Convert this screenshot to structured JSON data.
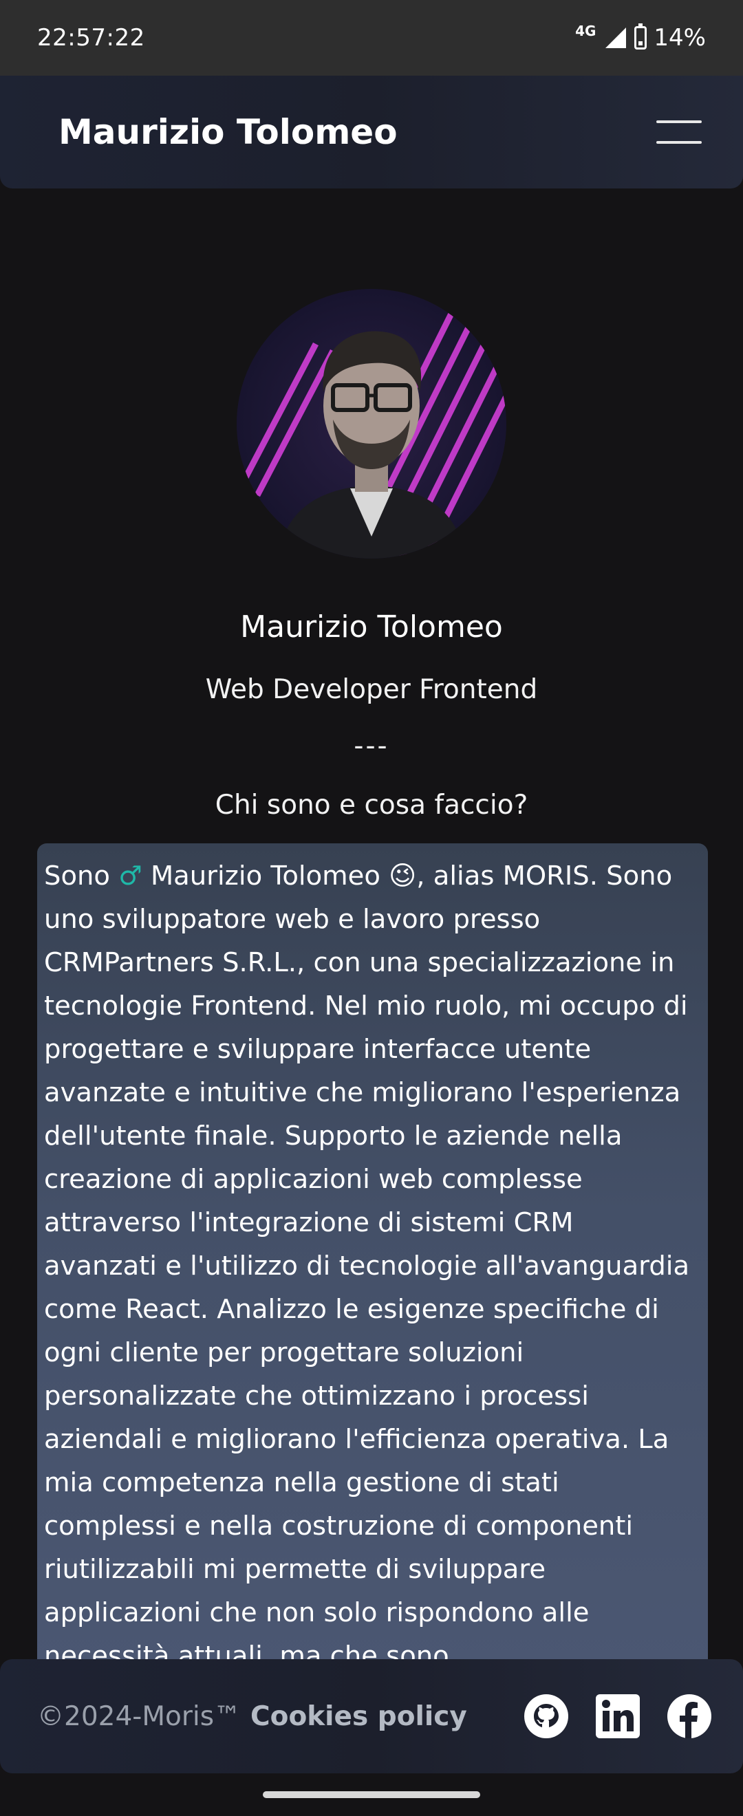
{
  "status_bar": {
    "time": "22:57:22",
    "network": "4G",
    "battery": "14%"
  },
  "header": {
    "brand": "Maurizio Tolomeo",
    "menu_icon": "hamburger-menu-icon"
  },
  "profile": {
    "name": "Maurizio Tolomeo",
    "role": "Web Developer Frontend",
    "divider": "---",
    "question": "Chi sono e cosa faccio?"
  },
  "bio": {
    "part1": "Sono ",
    "male_emoji": "♂",
    "part2": " Maurizio Tolomeo ",
    "wink_emoji": "😉",
    "part3": ", alias MORIS. Sono uno sviluppatore web e lavoro presso CRMPartners S.R.L., con una specializzazione in tecnologie Frontend. Nel mio ruolo, mi occupo di progettare e sviluppare interfacce utente avanzate e intuitive che migliorano l'esperienza dell'utente finale. Supporto le aziende nella creazione di applicazioni web complesse attraverso l'integrazione di sistemi CRM avanzati e l'utilizzo di tecnologie all'avanguardia come React. Analizzo le esigenze specifiche di ogni cliente per progettare soluzioni personalizzate che ottimizzano i processi aziendali e migliorano l'efficienza operativa. La mia competenza nella gestione di stati complessi e nella costruzione di componenti riutilizzabili mi permette di sviluppare applicazioni che non solo rispondono alle necessità attuali, ma che sono"
  },
  "footer": {
    "copyright": "©2024-Moris™",
    "cookies_label": "Cookies policy",
    "social_icons": [
      "github-icon",
      "linkedin-icon",
      "facebook-icon"
    ]
  },
  "colors": {
    "background": "#141315",
    "header": "#1e2333",
    "card": "#445068",
    "teal_accent": "#1fb8a8"
  }
}
